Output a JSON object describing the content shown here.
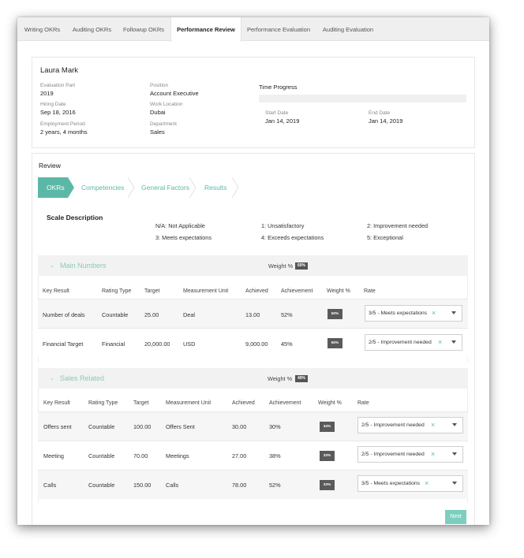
{
  "tabs": [
    "Writing OKRs",
    "Auditing OKRs",
    "Followup OKRs",
    "Performance Review",
    "Performance Evaluation",
    "Auditing Evaluation"
  ],
  "active_tab": "Performance Review",
  "employee": {
    "name": "Laura Mark",
    "evaluation_part_label": "Evaluation Part",
    "evaluation_part": "2019",
    "hiring_date_label": "Hiring Date",
    "hiring_date": "Sep 18, 2016",
    "employment_period_label": "Employment Period",
    "employment_period": "2 years, 4 months",
    "position_label": "Position",
    "position": "Account Executive",
    "work_location_label": "Work Location",
    "work_location": "Dubai",
    "department_label": "Department",
    "department": "Sales"
  },
  "time_progress": {
    "title": "Time Progress",
    "progress": 0,
    "start_label": "Start Date",
    "start": "Jan 14, 2019",
    "end_label": "End Date",
    "end": "Jan 14, 2019"
  },
  "review": {
    "title": "Review",
    "steps": [
      "OKRs",
      "Competencies",
      "General Factors",
      "Results"
    ],
    "active_step": "OKRs",
    "scale_title": "Scale Description",
    "scale": [
      "N/A: Not Applicable",
      "1: Unsatisfactory",
      "2: Improvement needed",
      "3: Meets expectations",
      "4: Exceeds expectations",
      "5: Exceptional"
    ]
  },
  "groups": [
    {
      "title": "Main Numbers",
      "weight_label": "Weight %",
      "weight": "60%",
      "headers": [
        "Key Result",
        "Rating Type",
        "Target",
        "Measurement Unit",
        "Achieved",
        "Achievement",
        "Weight %",
        "Rate"
      ],
      "rows": [
        {
          "key_result": "Number of deals",
          "rating_type": "Countable",
          "target": "25.00",
          "unit": "Deal",
          "achieved": "13.00",
          "achievement": "52%",
          "weight": "50%",
          "rate": "3/5 - Meets expectations"
        },
        {
          "key_result": "Financial Target",
          "rating_type": "Financial",
          "target": "20,000.00",
          "unit": "USD",
          "achieved": "9,000.00",
          "achievement": "45%",
          "weight": "50%",
          "rate": "2/5 - Improvement needed"
        }
      ]
    },
    {
      "title": "Sales Related",
      "weight_label": "Weight %",
      "weight": "40%",
      "headers": [
        "Key Result",
        "Rating Type",
        "Target",
        "Measurement Unit",
        "Achieved",
        "Achievement",
        "Weight %",
        "Rate"
      ],
      "rows": [
        {
          "key_result": "Offers sent",
          "rating_type": "Countable",
          "target": "100.00",
          "unit": "Offers Sent",
          "achieved": "30.00",
          "achievement": "30%",
          "weight": "34%",
          "rate": "2/5 - Improvement needed"
        },
        {
          "key_result": "Meeting",
          "rating_type": "Countable",
          "target": "70.00",
          "unit": "Meetings",
          "achieved": "27.00",
          "achievement": "38%",
          "weight": "33%",
          "rate": "2/5 - Improvement needed"
        },
        {
          "key_result": "Calls",
          "rating_type": "Countable",
          "target": "150.00",
          "unit": "Calls",
          "achieved": "78.00",
          "achievement": "52%",
          "weight": "33%",
          "rate": "3/5 - Meets expectations"
        }
      ]
    }
  ],
  "next_label": "Next",
  "colors": {
    "accent": "#5bb8a6",
    "accent_light": "#8cc9bc",
    "badge": "#555555"
  }
}
